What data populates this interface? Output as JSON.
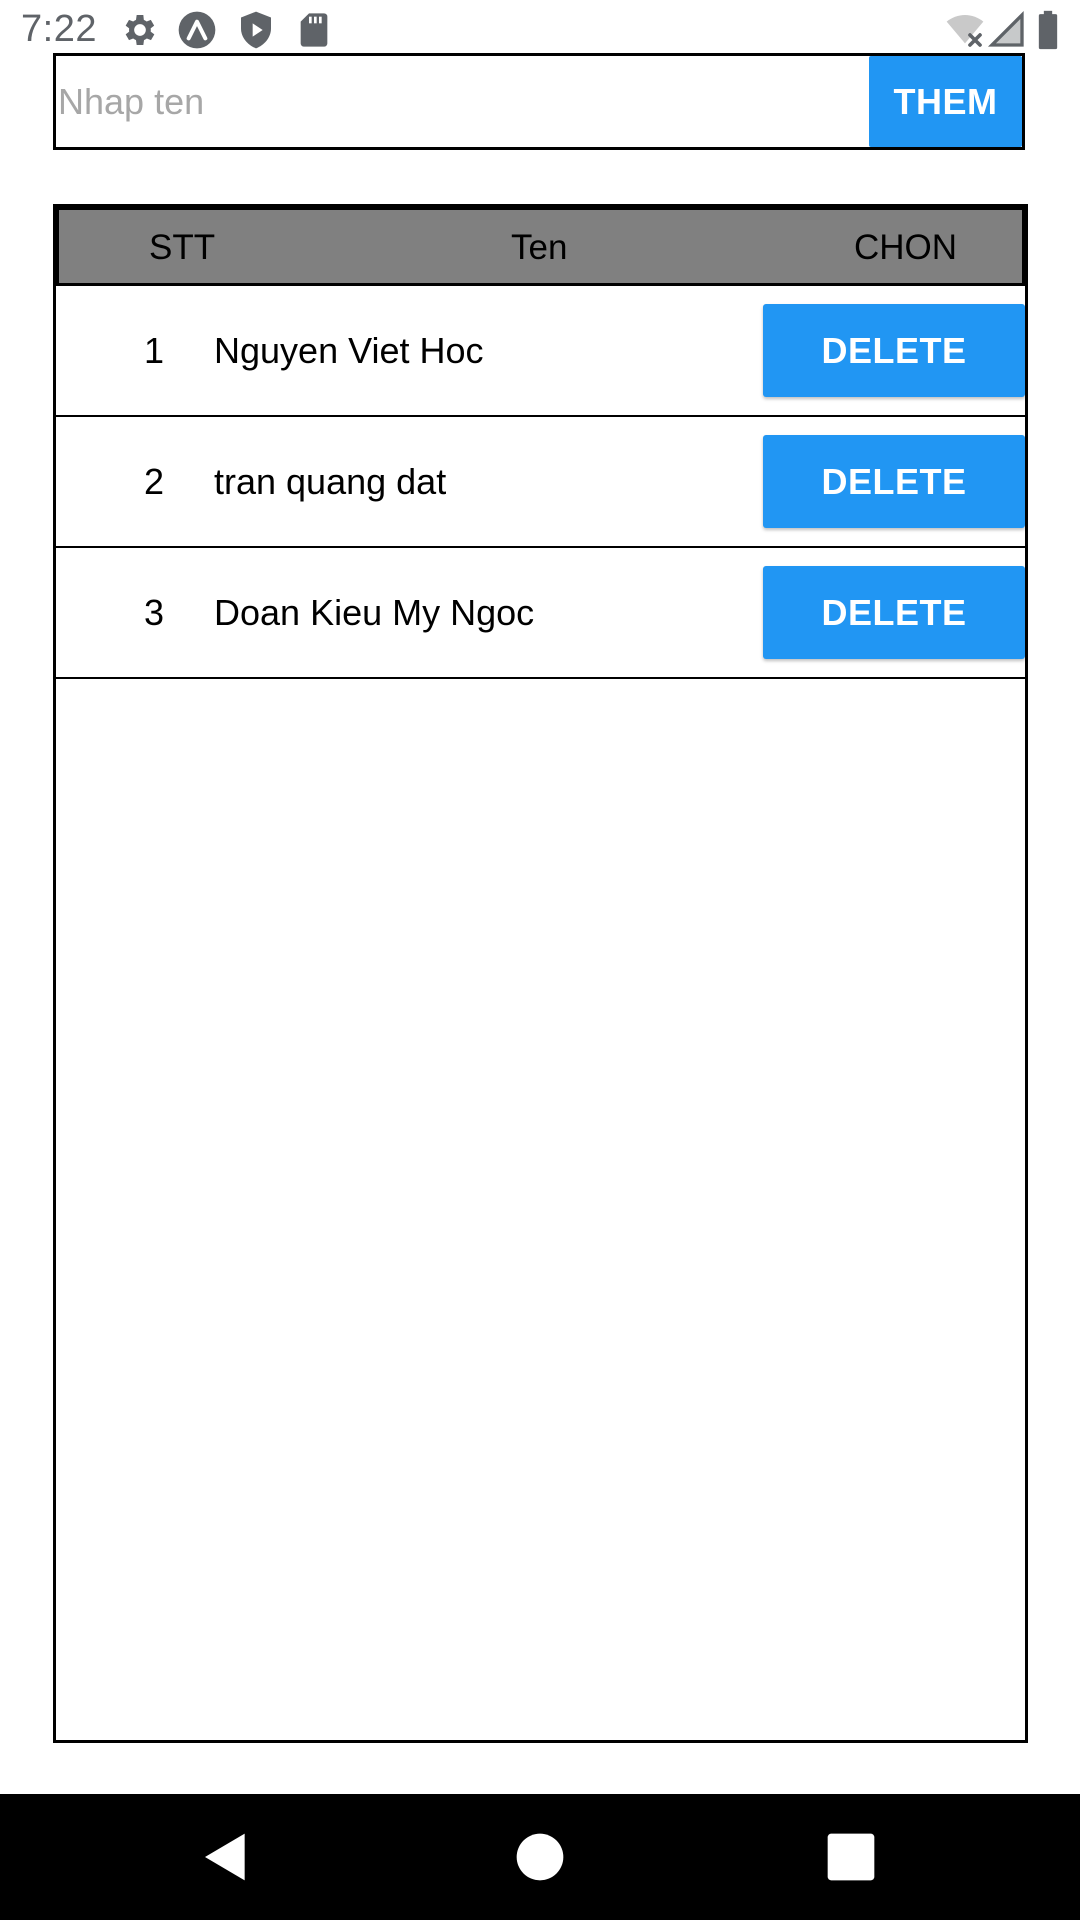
{
  "status_bar": {
    "time": "7:22",
    "icons": [
      "settings-icon",
      "expo-icon",
      "play-shield-icon",
      "sd-card-icon",
      "wifi-off-icon",
      "cell-signal-icon",
      "battery-icon"
    ]
  },
  "input": {
    "value": "",
    "placeholder": "Nhap ten"
  },
  "add_button_label": "THEM",
  "table": {
    "headers": {
      "stt": "STT",
      "name": "Ten",
      "action": "CHON"
    },
    "rows": [
      {
        "stt": "1",
        "name": "Nguyen Viet Hoc",
        "action": "DELETE"
      },
      {
        "stt": "2",
        "name": "tran quang dat",
        "action": "DELETE"
      },
      {
        "stt": "3",
        "name": "Doan Kieu My Ngoc",
        "action": "DELETE"
      }
    ]
  },
  "nav_bar": {
    "icons": [
      "back-icon",
      "home-icon",
      "recents-icon"
    ]
  },
  "colors": {
    "button": "#2196f3",
    "header_bg": "#808080",
    "status_icons": "#5f6368",
    "nav_bg": "#000000"
  }
}
